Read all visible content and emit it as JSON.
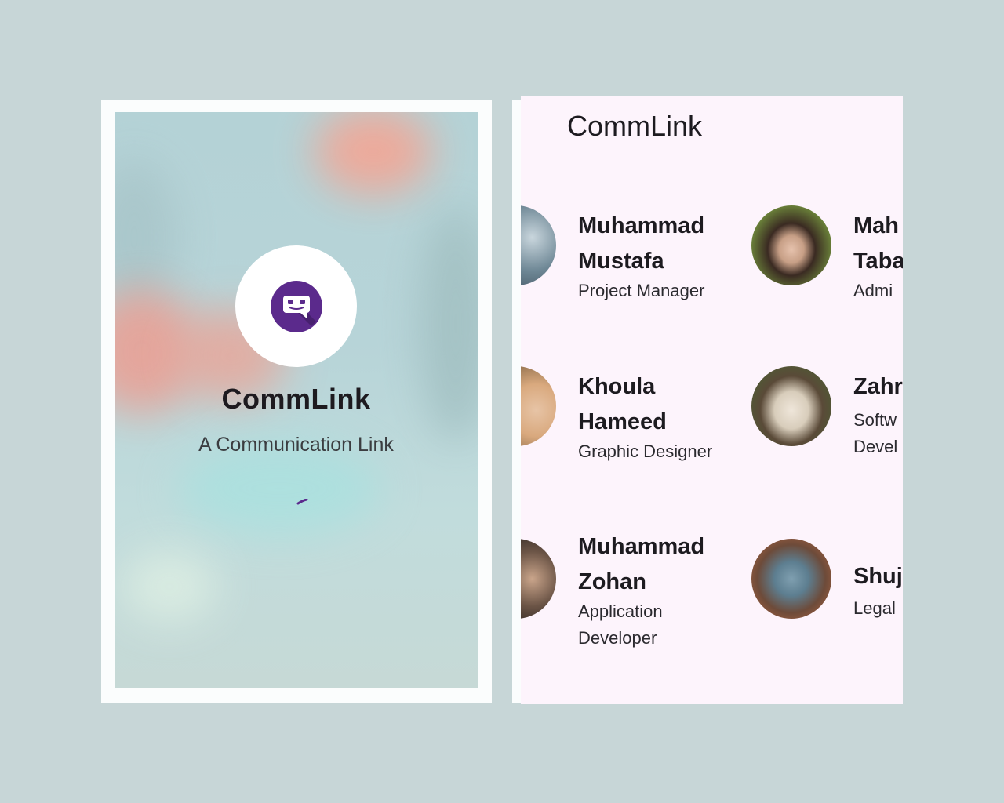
{
  "splash": {
    "app_name": "CommLink",
    "tagline": "A Communication Link",
    "logo_icon": "chat-bot-icon",
    "brand_color": "#5b2a8c"
  },
  "list": {
    "app_title": "CommLink",
    "members": [
      {
        "name": "Muhammad\nMustafa",
        "role": "Project Manager"
      },
      {
        "name": "Mah\nTaba",
        "role": "Admi"
      },
      {
        "name": "Khoula\nHameed",
        "role": "Graphic Designer"
      },
      {
        "name": "Zahr",
        "role": "Softw\nDevel"
      },
      {
        "name": "Muhammad\nZohan",
        "role": "Application\nDeveloper"
      },
      {
        "name": "Shuj",
        "role": "Legal"
      }
    ]
  }
}
